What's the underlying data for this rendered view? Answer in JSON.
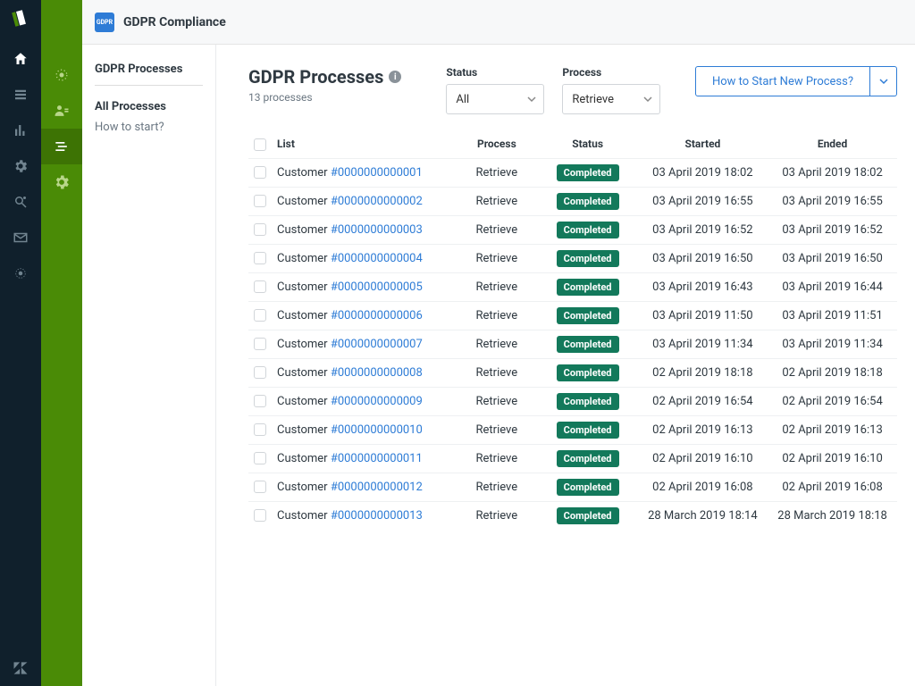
{
  "topbar": {
    "app_name": "GDPR Compliance",
    "badge_text": "GDPR"
  },
  "side_menu": {
    "heading": "GDPR Processes",
    "items": [
      {
        "label": "All Processes"
      },
      {
        "label": "How to start?"
      }
    ]
  },
  "page": {
    "title": "GDPR Processes",
    "count_text": "13 processes"
  },
  "filters": {
    "status": {
      "label": "Status",
      "value": "All"
    },
    "process": {
      "label": "Process",
      "value": "Retrieve"
    }
  },
  "actions": {
    "new_process_label": "How to Start New Process?"
  },
  "table": {
    "headers": {
      "list": "List",
      "process": "Process",
      "status": "Status",
      "started": "Started",
      "ended": "Ended"
    },
    "rows": [
      {
        "customer_prefix": "Customer ",
        "customer_id": "#0000000000001",
        "process": "Retrieve",
        "status": "Completed",
        "started": "03 April 2019 18:02",
        "ended": "03 April 2019 18:02"
      },
      {
        "customer_prefix": "Customer ",
        "customer_id": "#0000000000002",
        "process": "Retrieve",
        "status": "Completed",
        "started": "03 April 2019 16:55",
        "ended": "03 April 2019 16:55"
      },
      {
        "customer_prefix": "Customer ",
        "customer_id": "#0000000000003",
        "process": "Retrieve",
        "status": "Completed",
        "started": "03 April 2019 16:52",
        "ended": "03 April 2019 16:52"
      },
      {
        "customer_prefix": "Customer ",
        "customer_id": "#0000000000004",
        "process": "Retrieve",
        "status": "Completed",
        "started": "03 April 2019 16:50",
        "ended": "03 April 2019 16:50"
      },
      {
        "customer_prefix": "Customer ",
        "customer_id": "#0000000000005",
        "process": "Retrieve",
        "status": "Completed",
        "started": "03 April 2019 16:43",
        "ended": "03 April 2019 16:44"
      },
      {
        "customer_prefix": "Customer ",
        "customer_id": "#0000000000006",
        "process": "Retrieve",
        "status": "Completed",
        "started": "03 April 2019 11:50",
        "ended": "03 April 2019 11:51"
      },
      {
        "customer_prefix": "Customer ",
        "customer_id": "#0000000000007",
        "process": "Retrieve",
        "status": "Completed",
        "started": "03 April 2019 11:34",
        "ended": "03 April 2019 11:34"
      },
      {
        "customer_prefix": "Customer ",
        "customer_id": "#0000000000008",
        "process": "Retrieve",
        "status": "Completed",
        "started": "02 April 2019 18:18",
        "ended": "02 April 2019 18:18"
      },
      {
        "customer_prefix": "Customer ",
        "customer_id": "#0000000000009",
        "process": "Retrieve",
        "status": "Completed",
        "started": "02 April 2019 16:54",
        "ended": "02 April 2019 16:54"
      },
      {
        "customer_prefix": "Customer ",
        "customer_id": "#0000000000010",
        "process": "Retrieve",
        "status": "Completed",
        "started": "02 April 2019 16:13",
        "ended": "02 April 2019 16:13"
      },
      {
        "customer_prefix": "Customer ",
        "customer_id": "#0000000000011",
        "process": "Retrieve",
        "status": "Completed",
        "started": "02 April 2019 16:10",
        "ended": "02 April 2019 16:10"
      },
      {
        "customer_prefix": "Customer ",
        "customer_id": "#0000000000012",
        "process": "Retrieve",
        "status": "Completed",
        "started": "02 April 2019 16:08",
        "ended": "02 April 2019 16:08"
      },
      {
        "customer_prefix": "Customer ",
        "customer_id": "#0000000000013",
        "process": "Retrieve",
        "status": "Completed",
        "started": "28 March 2019 18:14",
        "ended": "28 March 2019 18:18"
      }
    ]
  }
}
